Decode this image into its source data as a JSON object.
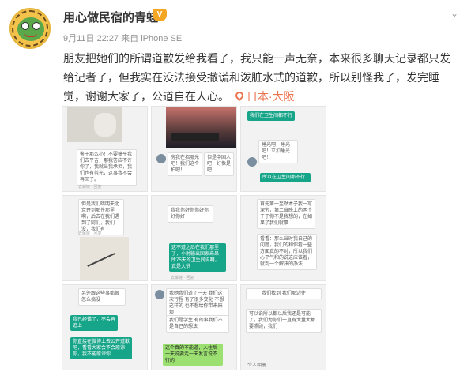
{
  "user": {
    "name": "用心做民宿的青蛙",
    "vip_badge": "V"
  },
  "post": {
    "time_source": "9月11日 22:27 来自 iPhone SE",
    "more_icon": "chevron-down-icon",
    "text_1": "朋友把她们的所谓道歉发给我看了，我只能一声无奈，本来很多聊天记录都只发",
    "text_2": "给记者了，但我实在没法接受撒谎和泼脏水式的道歉，所以别怪我了，发完睡",
    "text_3": "觉，谢谢大家了，公道自在人心。",
    "location": "日本·大阪"
  },
  "images": [
    {
      "name": "screenshot-1",
      "b1": "鉴于那么小！不要搞乎我们去平吉，那我答应不许你了，我就当我承担，我们也有剪光，这事我不会再回了。",
      "b2": "去解链 · 回复"
    },
    {
      "name": "screenshot-2",
      "b1": "房我在招哪光吧！我们这个拍吧！",
      "b2": "但是中国人吧！好像是吧！"
    },
    {
      "name": "screenshot-3",
      "b1": "我们在卫生间都不行",
      "b2": "睡光吧！睡光吧！立扣睡光吧！",
      "b3": "所以在卫生间都不行"
    },
    {
      "name": "screenshot-4",
      "b1": "但是我们暗明天北京开到那件那里啊，后去在我们遇到了阿们，我们没，我们有",
      "b2": "去解链 · 回复"
    },
    {
      "name": "screenshot-5",
      "b1": "我我你好你你好你好你好",
      "b2": "这不道之后在我们那里了，小射输出国家来呆，所75天的卫生间说啊，真是大爷",
      "b3": "去解链 · 回复"
    },
    {
      "name": "screenshot-6",
      "b1": "首先第一至然本子我一写深究，第二当晚上的两个于于你不是我想的，在如果了我们就事",
      "b2": "看看：那么当时我自己的问题，我们的和你看一些方面真的不对，所以我们心平气和的说这应该着，就到一个解决的办法"
    },
    {
      "name": "screenshot-7",
      "b1": "另外跟这些事都很怎么搞没",
      "b2": "我已经错了，不会再追上",
      "b3": "你直接在微博上去公开道歉吧，看看大家会不会原谅你，我不能原谅你"
    },
    {
      "name": "screenshot-8",
      "b1": "我她我们道了一天 我们这次行程 有了很多变化 不想这样的 也不想给你带来麻烦",
      "b2": "我们是学生 有的事我们不是自己的想法",
      "b3": "这个真的不能道，入住后一天说要走一天发言说不行的"
    },
    {
      "name": "screenshot-9",
      "b1": "我们找到 我们那边住",
      "b2": "可以说所以都以后我还是可能了，我们为你们一直有大量大都要照顾，我们",
      "b3": "个人相册"
    }
  ]
}
